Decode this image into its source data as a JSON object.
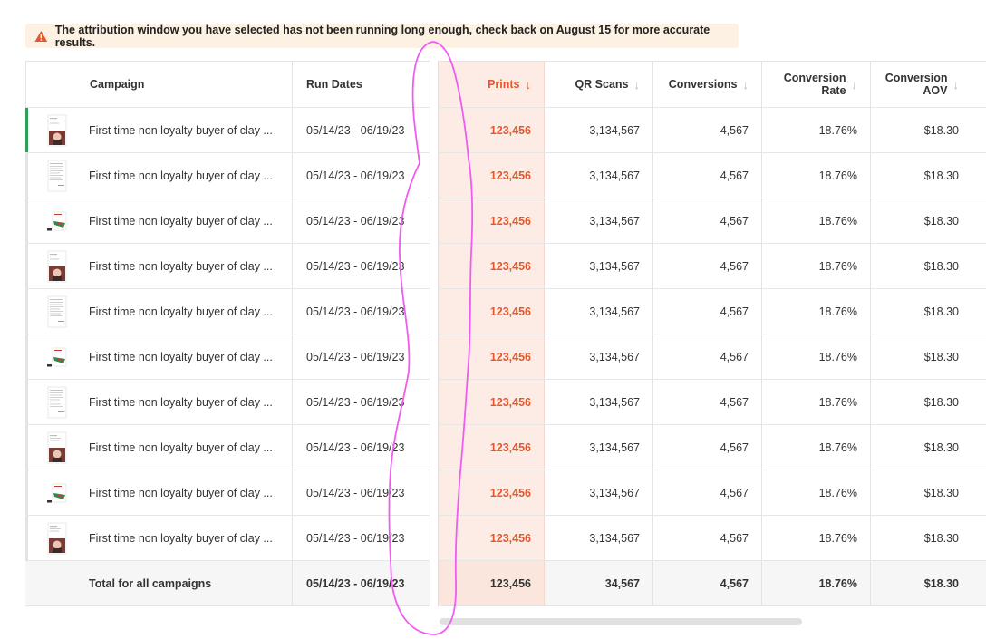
{
  "banner": {
    "icon": "warning-triangle-icon",
    "color": "#e2582c",
    "text": "The attribution window you have selected has not been running long enough, check back on August 15 for more accurate results."
  },
  "table": {
    "columns": {
      "campaign": "Campaign",
      "run_dates": "Run Dates",
      "prints": "Prints",
      "qr_scans": "QR Scans",
      "conversions": "Conversions",
      "conversion_rate": "Conversion Rate",
      "conversion_aov": "Conversion AOV"
    },
    "sort_arrow": "↓",
    "rows": [
      {
        "thumb": "photo-postcard",
        "campaign": "First time non loyalty buyer of clay ...",
        "dates": "05/14/23  -  06/19/23",
        "prints": "123,456",
        "qr": "3,134,567",
        "conv": "4,567",
        "rate": "18.76%",
        "aov": "$18.30"
      },
      {
        "thumb": "letter",
        "campaign": "First time non loyalty buyer of clay ...",
        "dates": "05/14/23  -  06/19/23",
        "prints": "123,456",
        "qr": "3,134,567",
        "conv": "4,567",
        "rate": "18.76%",
        "aov": "$18.30"
      },
      {
        "thumb": "product-card",
        "campaign": "First time non loyalty buyer of clay ...",
        "dates": "05/14/23  -  06/19/23",
        "prints": "123,456",
        "qr": "3,134,567",
        "conv": "4,567",
        "rate": "18.76%",
        "aov": "$18.30"
      },
      {
        "thumb": "photo-postcard",
        "campaign": "First time non loyalty buyer of clay ...",
        "dates": "05/14/23  -  06/19/23",
        "prints": "123,456",
        "qr": "3,134,567",
        "conv": "4,567",
        "rate": "18.76%",
        "aov": "$18.30"
      },
      {
        "thumb": "letter",
        "campaign": "First time non loyalty buyer of clay ...",
        "dates": "05/14/23  -  06/19/23",
        "prints": "123,456",
        "qr": "3,134,567",
        "conv": "4,567",
        "rate": "18.76%",
        "aov": "$18.30"
      },
      {
        "thumb": "product-card",
        "campaign": "First time non loyalty buyer of clay ...",
        "dates": "05/14/23  -  06/19/23",
        "prints": "123,456",
        "qr": "3,134,567",
        "conv": "4,567",
        "rate": "18.76%",
        "aov": "$18.30"
      },
      {
        "thumb": "letter",
        "campaign": "First time non loyalty buyer of clay ...",
        "dates": "05/14/23  -  06/19/23",
        "prints": "123,456",
        "qr": "3,134,567",
        "conv": "4,567",
        "rate": "18.76%",
        "aov": "$18.30"
      },
      {
        "thumb": "photo-postcard",
        "campaign": "First time non loyalty buyer of clay ...",
        "dates": "05/14/23  -  06/19/23",
        "prints": "123,456",
        "qr": "3,134,567",
        "conv": "4,567",
        "rate": "18.76%",
        "aov": "$18.30"
      },
      {
        "thumb": "product-card",
        "campaign": "First time non loyalty buyer of clay ...",
        "dates": "05/14/23  -  06/19/23",
        "prints": "123,456",
        "qr": "3,134,567",
        "conv": "4,567",
        "rate": "18.76%",
        "aov": "$18.30"
      },
      {
        "thumb": "photo-postcard",
        "campaign": "First time non loyalty buyer of clay ...",
        "dates": "05/14/23  -  06/19/23",
        "prints": "123,456",
        "qr": "3,134,567",
        "conv": "4,567",
        "rate": "18.76%",
        "aov": "$18.30"
      }
    ],
    "total": {
      "label": "Total for all campaigns",
      "dates": "05/14/23 - 06/19/23",
      "prints": "123,456",
      "qr": "34,567",
      "conv": "4,567",
      "rate": "18.76%",
      "aov": "$18.30"
    }
  },
  "colors": {
    "accent": "#e2582c",
    "active_row_bar": "#2f9e58",
    "highlight_column": "#fdece6",
    "annotation_stroke": "#f05cf0"
  }
}
